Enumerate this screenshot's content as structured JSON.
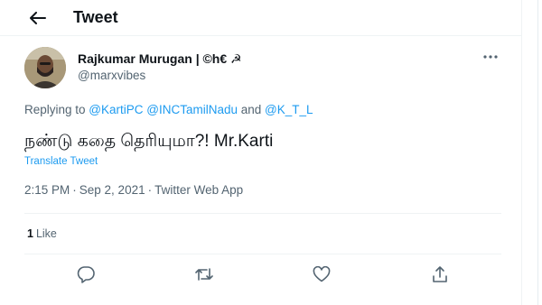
{
  "header": {
    "title": "Tweet"
  },
  "author": {
    "name": "Rajkumar Murugan | ©h€ ☭",
    "handle": "@marxvibes"
  },
  "replying": {
    "prefix": "Replying to ",
    "mention_1": "@KartiPC",
    "mention_2": "@INCTamilNadu",
    "and": " and ",
    "mention_3": "@K_T_L"
  },
  "tweet": {
    "text": "நண்டு கதை தெரியுமா?! Mr.Karti",
    "translate_label": "Translate Tweet"
  },
  "meta": {
    "time": "2:15 PM",
    "date": "Sep 2, 2021",
    "source": "Twitter Web App",
    "separator": "·"
  },
  "stats": {
    "likes_count": "1",
    "likes_label": "Like"
  },
  "colors": {
    "accent": "#1d9bf0",
    "secondary_text": "#536471",
    "divider": "#eff3f4"
  },
  "icons": [
    "back-arrow-icon",
    "more-icon",
    "reply-icon",
    "retweet-icon",
    "like-icon",
    "share-icon"
  ]
}
